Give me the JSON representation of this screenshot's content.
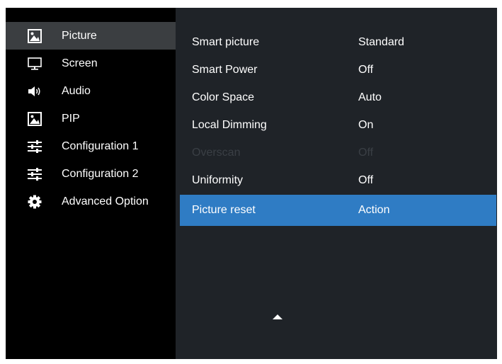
{
  "sidebar": {
    "items": [
      {
        "label": "Picture",
        "icon": "picture-icon",
        "selected": true
      },
      {
        "label": "Screen",
        "icon": "monitor-icon",
        "selected": false
      },
      {
        "label": "Audio",
        "icon": "speaker-icon",
        "selected": false
      },
      {
        "label": "PIP",
        "icon": "picture-in-picture-icon",
        "selected": false
      },
      {
        "label": "Configuration 1",
        "icon": "sliders-icon",
        "selected": false
      },
      {
        "label": "Configuration 2",
        "icon": "sliders-icon",
        "selected": false
      },
      {
        "label": "Advanced Option",
        "icon": "gear-icon",
        "selected": false
      }
    ]
  },
  "settings": {
    "rows": [
      {
        "label": "Smart picture",
        "value": "Standard",
        "enabled": true,
        "highlighted": false
      },
      {
        "label": "Smart Power",
        "value": "Off",
        "enabled": true,
        "highlighted": false
      },
      {
        "label": "Color Space",
        "value": "Auto",
        "enabled": true,
        "highlighted": false
      },
      {
        "label": "Local Dimming",
        "value": "On",
        "enabled": true,
        "highlighted": false
      },
      {
        "label": "Overscan",
        "value": "Off",
        "enabled": false,
        "highlighted": false
      },
      {
        "label": "Uniformity",
        "value": "Off",
        "enabled": true,
        "highlighted": false
      },
      {
        "label": "Picture reset",
        "value": "Action",
        "enabled": true,
        "highlighted": true
      }
    ]
  },
  "colors": {
    "sidebar_bg": "#000000",
    "sidebar_selected": "#3b3e41",
    "panel_bg": "#1f2328",
    "highlight": "#2f7cc4",
    "disabled_text": "#3a3f45",
    "text": "#ffffff"
  }
}
